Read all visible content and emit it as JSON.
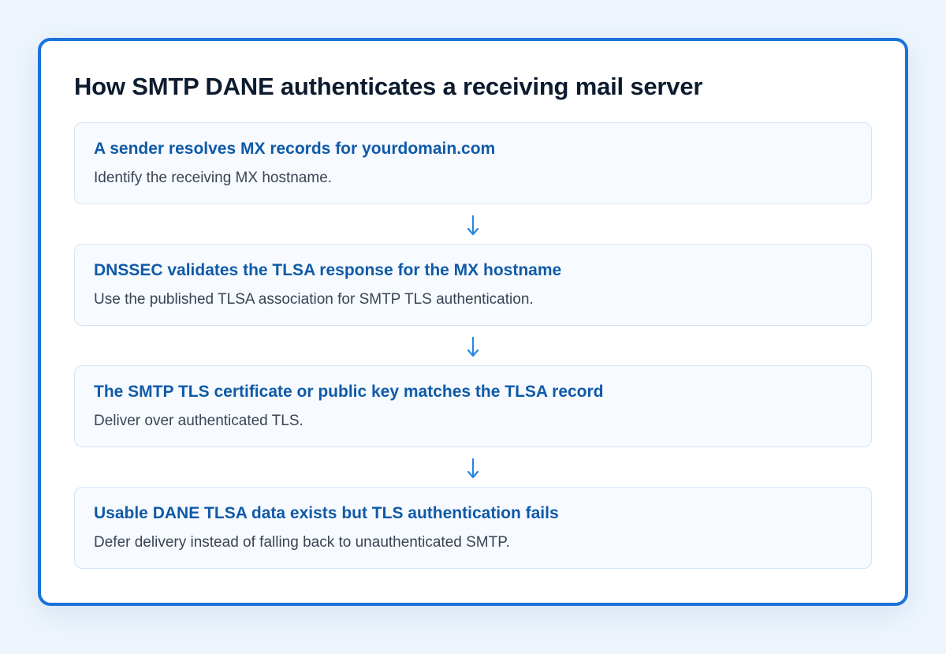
{
  "diagram": {
    "title": "How SMTP DANE authenticates a receiving mail server",
    "steps": [
      {
        "title": "A sender resolves MX records for yourdomain.com",
        "description": "Identify the receiving MX hostname."
      },
      {
        "title": "DNSSEC validates the TLSA response for the MX hostname",
        "description": "Use the published TLSA association for SMTP TLS authentication."
      },
      {
        "title": "The SMTP TLS certificate or public key matches the TLSA record",
        "description": "Deliver over authenticated TLS."
      },
      {
        "title": "Usable DANE TLSA data exists but TLS authentication fails",
        "description": "Defer delivery instead of falling back to unauthenticated SMTP."
      }
    ]
  },
  "colors": {
    "frame_border": "#1a73d9",
    "step_title": "#0f5aa8",
    "arrow": "#2a86e3",
    "heading": "#0d1b2e"
  },
  "icons": {
    "connector": "arrow-down-icon"
  }
}
